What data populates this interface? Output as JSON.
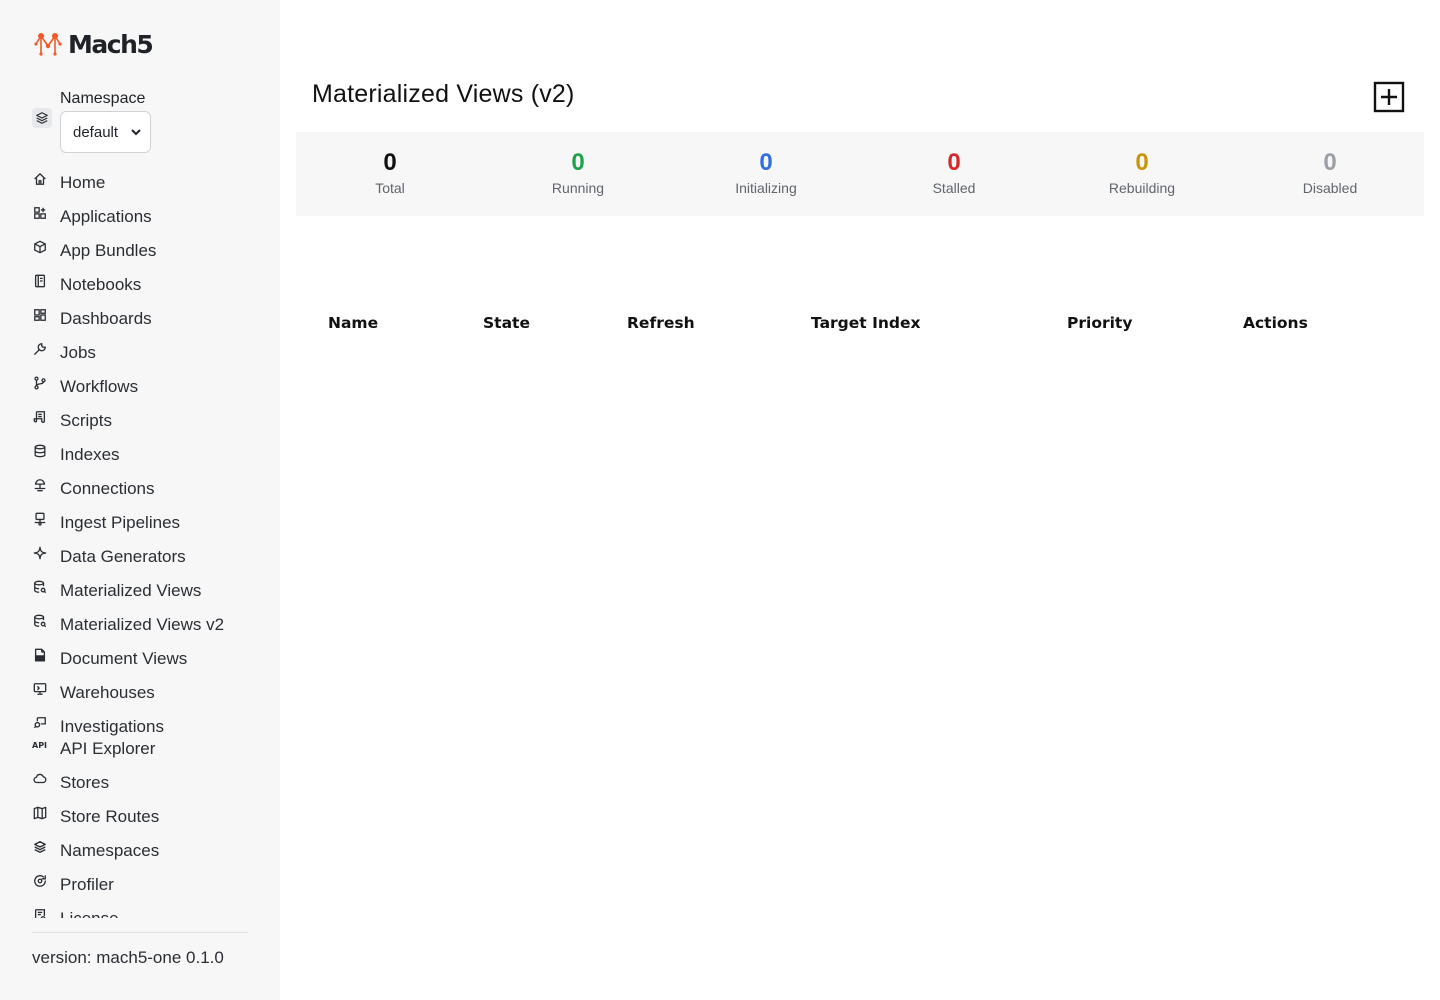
{
  "app": {
    "name": "Mach5"
  },
  "namespace": {
    "label": "Namespace",
    "selected": "default"
  },
  "nav": {
    "items": [
      {
        "label": "Home",
        "icon": "home-icon"
      },
      {
        "label": "Applications",
        "icon": "apps-icon"
      },
      {
        "label": "App Bundles",
        "icon": "package-icon"
      },
      {
        "label": "Notebooks",
        "icon": "notebook-icon"
      },
      {
        "label": "Dashboards",
        "icon": "dashboard-icon"
      },
      {
        "label": "Jobs",
        "icon": "wrench-icon"
      },
      {
        "label": "Workflows",
        "icon": "branch-icon"
      },
      {
        "label": "Scripts",
        "icon": "script-icon"
      },
      {
        "label": "Indexes",
        "icon": "database-icon"
      },
      {
        "label": "Connections",
        "icon": "connection-icon"
      },
      {
        "label": "Ingest Pipelines",
        "icon": "pipeline-icon"
      },
      {
        "label": "Data Generators",
        "icon": "sparkle-icon"
      },
      {
        "label": "Materialized Views",
        "icon": "database-search-icon"
      },
      {
        "label": "Materialized Views v2",
        "icon": "database-search-icon"
      },
      {
        "label": "Document Views",
        "icon": "document-icon"
      },
      {
        "label": "Warehouses",
        "icon": "monitor-icon"
      },
      {
        "label": "Investigations",
        "icon": "investigation-icon"
      },
      {
        "label": "API Explorer",
        "icon": "api-icon"
      },
      {
        "label": "Stores",
        "icon": "cloud-icon"
      },
      {
        "label": "Store Routes",
        "icon": "map-icon"
      },
      {
        "label": "Namespaces",
        "icon": "layers-icon"
      },
      {
        "label": "Profiler",
        "icon": "profiler-icon"
      },
      {
        "label": "License",
        "icon": "license-icon"
      }
    ]
  },
  "footer": {
    "version": "version: mach5-one 0.1.0"
  },
  "page": {
    "title": "Materialized Views (v2)"
  },
  "stats": [
    {
      "value": "0",
      "label": "Total",
      "color": "#111111"
    },
    {
      "value": "0",
      "label": "Running",
      "color": "#1fa04a"
    },
    {
      "value": "0",
      "label": "Initializing",
      "color": "#2f6fe0"
    },
    {
      "value": "0",
      "label": "Stalled",
      "color": "#d62828"
    },
    {
      "value": "0",
      "label": "Rebuilding",
      "color": "#c9950a"
    },
    {
      "value": "0",
      "label": "Disabled",
      "color": "#9aa0a6"
    }
  ],
  "table": {
    "columns": [
      "Name",
      "State",
      "Refresh",
      "Target Index",
      "Priority",
      "Actions"
    ]
  },
  "colors": {
    "brand": "#f15a29",
    "sidebar_bg": "#f7f7f8"
  }
}
